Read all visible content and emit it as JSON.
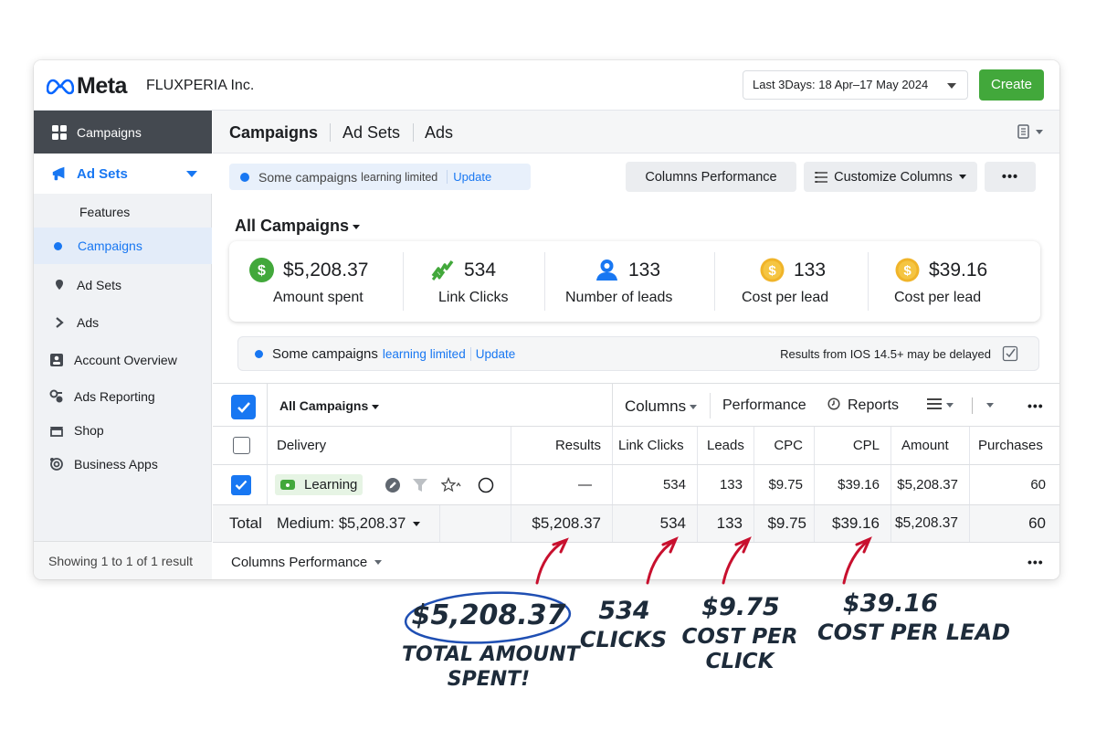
{
  "header": {
    "logo_text": "Meta",
    "company": "FLUXPERIA Inc.",
    "date_range": "Last 3Days: 18 Apr–17 May 2024",
    "create_label": "Create"
  },
  "sidebar": {
    "campaigns_label": "Campaigns",
    "adsets_label": "Ad Sets",
    "features_label": "Features",
    "sub_campaigns_label": "Campaigns",
    "items": [
      {
        "label": "Ad Sets",
        "icon": "pin-icon"
      },
      {
        "label": "Ads",
        "icon": "arrow-icon"
      },
      {
        "label": "Account Overview",
        "icon": "account-icon"
      },
      {
        "label": "Ads Reporting",
        "icon": "reporting-icon"
      },
      {
        "label": "Shop",
        "icon": "shop-icon"
      },
      {
        "label": "Business Apps",
        "icon": "apps-icon"
      }
    ],
    "footer": "Showing 1 to 1 of 1 result"
  },
  "tabs": [
    "Campaigns",
    "Ad Sets",
    "Ads"
  ],
  "toolbar": {
    "pill_text": "Some  campaigns",
    "pill_small": "learning limited",
    "pill_link": "Update",
    "columns_performance": "Columns  Performance",
    "customize_columns": "Customize Columns",
    "more": "•••"
  },
  "all_campaigns_title": "All Campaigns",
  "metrics": [
    {
      "value": "$5,208.37",
      "label": "Amount spent",
      "icon": "dollar-icon",
      "color": "#42a83b"
    },
    {
      "value": "534",
      "label": "Link Clicks",
      "icon": "clicks-icon",
      "color": "#42a83b"
    },
    {
      "value": "133",
      "label": "Number of leads",
      "icon": "person-icon",
      "color": "#1877f2"
    },
    {
      "value": "133",
      "label": "Cost per lead",
      "icon": "coin-icon",
      "color": "#f0b429"
    },
    {
      "value": "$39.16",
      "label": "Cost per lead",
      "icon": "coin-icon",
      "color": "#f0b429"
    }
  ],
  "notice": {
    "text": "Some campaigns",
    "blue": "learning limited",
    "link": "Update",
    "right": "Results from IOS 14.5+ may be delayed"
  },
  "table_toolbar": {
    "all_campaigns": "All Campaigns",
    "columns": "Columns",
    "performance": "Performance",
    "reports": "Reports",
    "more": "•••"
  },
  "table": {
    "headers": [
      "Delivery",
      "Results",
      "Link Clicks",
      "Leads",
      "CPC",
      "CPL",
      "Amount",
      "Purchases"
    ],
    "row": {
      "delivery": "Learning",
      "results": "—",
      "link_clicks": "534",
      "leads": "133",
      "cpc": "$9.75",
      "cpl": "$39.16",
      "amount": "$5,208.37",
      "purchases": "60"
    },
    "total": {
      "label": "Total",
      "medium": "Medium: $5,208.37",
      "results": "$5,208.37",
      "link_clicks": "534",
      "leads": "133",
      "cpc": "$9.75",
      "cpl": "$39.16",
      "amount": "$5,208.37",
      "purchases": "60"
    },
    "footer_columns": "Columns  Performance",
    "footer_more": "•••"
  },
  "annotations": [
    {
      "value": "$5,208.37",
      "caption": "TOTAL AMOUNT",
      "caption2": "SPENT!"
    },
    {
      "value": "534",
      "caption": "CLICKS"
    },
    {
      "value": "$9.75",
      "caption": "COST PER",
      "caption2": "CLICK"
    },
    {
      "value": "$39.16",
      "caption": "COST PER LEAD"
    }
  ],
  "colors": {
    "accent": "#1877f2",
    "green": "#42a83b",
    "arrow": "#c8102e",
    "ink": "#1d2b3a"
  }
}
